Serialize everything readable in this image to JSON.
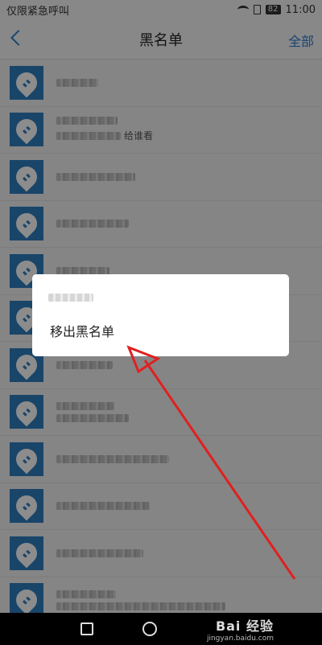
{
  "status_bar": {
    "carrier": "仅限紧急呼叫",
    "battery": "82",
    "time": "11:00"
  },
  "title_bar": {
    "title": "黑名单",
    "all_label": "全部"
  },
  "list": {
    "row_count": 12,
    "visible_subtitle_fragment": "给谁看"
  },
  "dialog": {
    "action_label": "移出黑名单"
  },
  "watermark": {
    "brand": "Bai 经验",
    "url": "jingyan.baidu.com"
  },
  "colors": {
    "accent": "#2a7fd2",
    "avatar": "#2e7fc0",
    "arrow": "#e02020"
  }
}
